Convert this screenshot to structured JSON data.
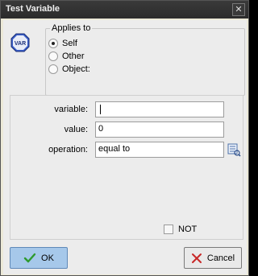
{
  "window": {
    "title": "Test Variable",
    "close_glyph": "✕"
  },
  "icon": {
    "name": "var-icon",
    "text": "VAR"
  },
  "applies_to": {
    "label": "Applies to",
    "options": [
      {
        "label": "Self",
        "checked": true
      },
      {
        "label": "Other",
        "checked": false
      },
      {
        "label": "Object:",
        "checked": false
      }
    ]
  },
  "fields": {
    "variable": {
      "label": "variable:",
      "value": ""
    },
    "value": {
      "label": "value:",
      "value": "0"
    },
    "operation": {
      "label": "operation:",
      "value": "equal to"
    }
  },
  "not_checkbox": {
    "label": "NOT",
    "checked": false
  },
  "buttons": {
    "ok_label": "OK",
    "cancel_label": "Cancel"
  },
  "colors": {
    "titlebar": "#2f2f2f",
    "ok_button": "#a6c8ea",
    "dialog_bg": "#ececec",
    "ok_check": "#2e9a2e",
    "cancel_x": "#c82828"
  }
}
